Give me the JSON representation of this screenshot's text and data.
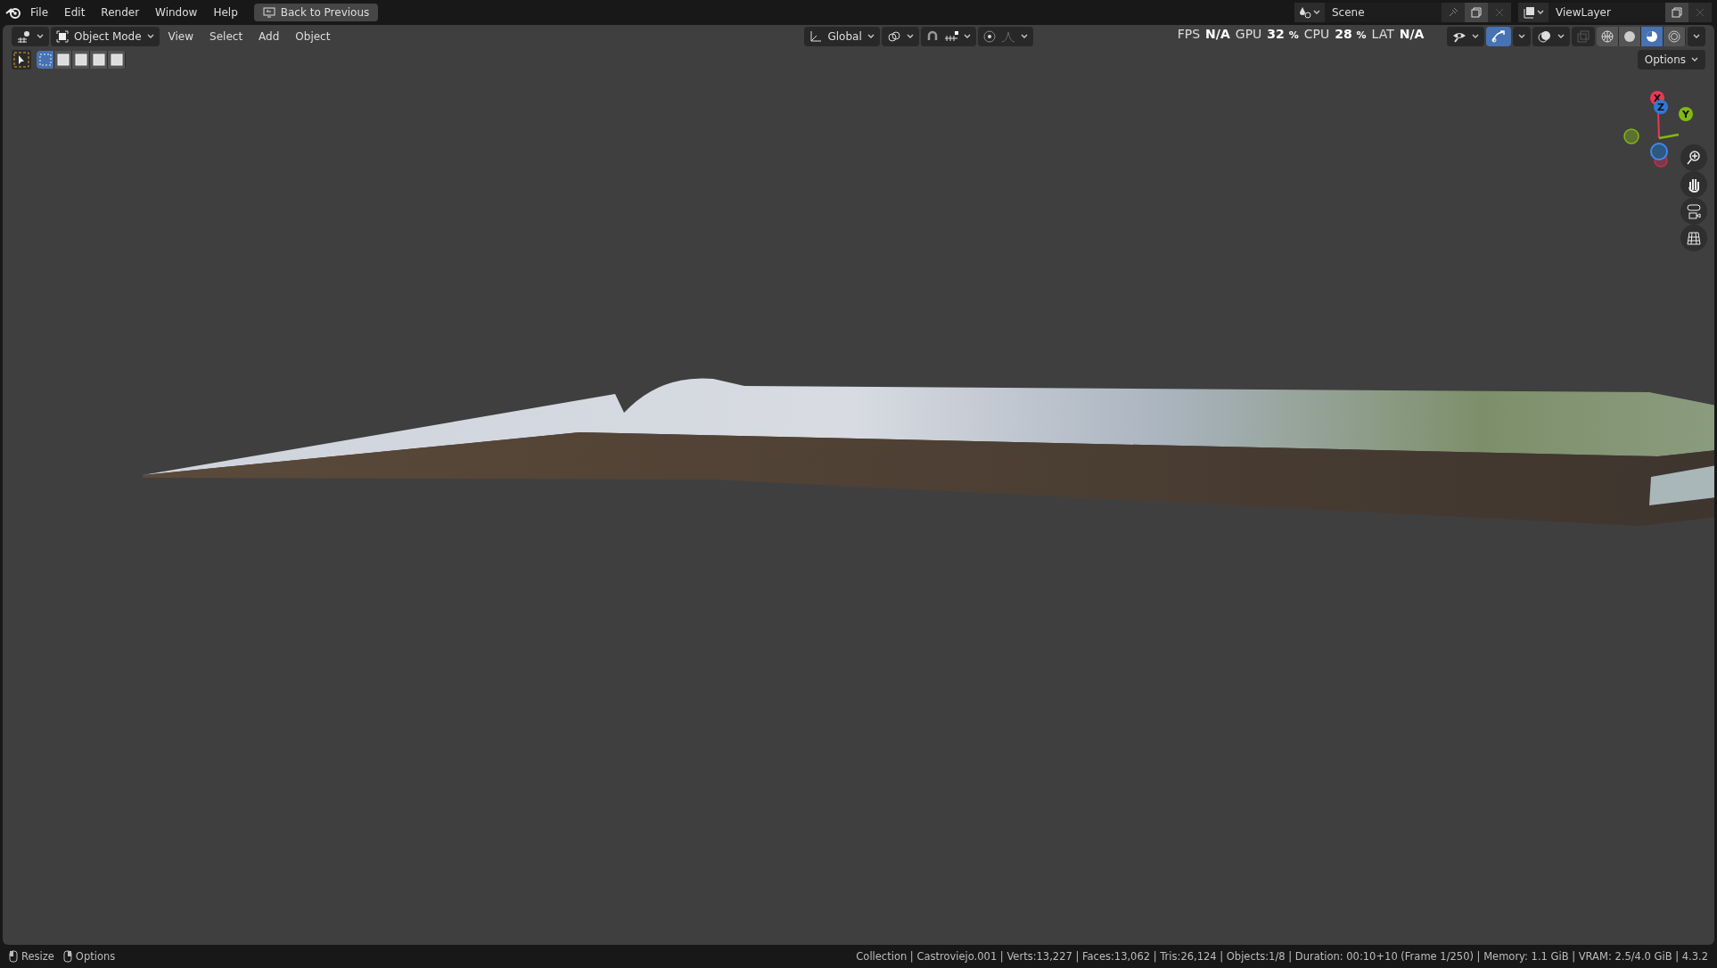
{
  "top_bar": {
    "menus": [
      "File",
      "Edit",
      "Render",
      "Window",
      "Help"
    ],
    "back_button": "Back to Previous",
    "scene": "Scene",
    "view_layer": "ViewLayer"
  },
  "header": {
    "mode": "Object Mode",
    "menus": [
      "View",
      "Select",
      "Add",
      "Object"
    ],
    "orientation": "Global",
    "stats": [
      {
        "label": "FPS",
        "value": "N/A"
      },
      {
        "label": "GPU",
        "value": "32",
        "unit": "%"
      },
      {
        "label": "CPU",
        "value": "28",
        "unit": "%"
      },
      {
        "label": "LAT",
        "value": "N/A"
      }
    ],
    "overlay_gizmo_on": true,
    "shading_modes": [
      {
        "selected": false
      },
      {
        "selected": false
      },
      {
        "selected": true
      },
      {
        "selected": false
      }
    ]
  },
  "tool_header": {
    "select_modes": [
      {
        "selected": true
      },
      {
        "selected": false
      },
      {
        "selected": false
      },
      {
        "selected": false
      },
      {
        "selected": false
      }
    ],
    "options": "Options"
  },
  "gizmo": {
    "axes": [
      "X",
      "Y",
      "Z"
    ]
  },
  "status_bar": {
    "left": [
      "Resize",
      "Options"
    ],
    "info": "Collection | Castroviejo.001 | Verts:13,227 | Faces:13,062 | Tris:26,124 | Objects:1/8 | Duration: 00:10+10 (Frame 1/250) | Memory: 1.1 GiB | VRAM: 2.5/4.0 GiB | 4.3.2"
  }
}
